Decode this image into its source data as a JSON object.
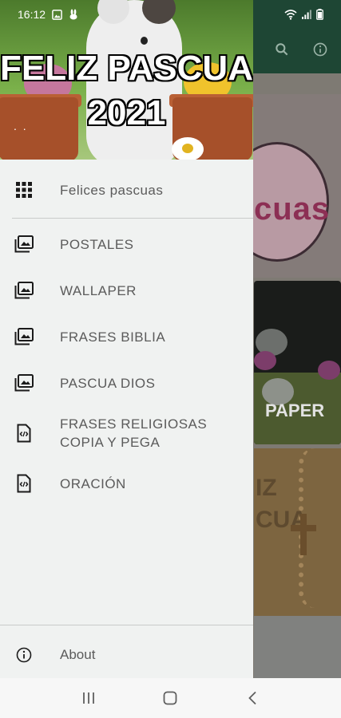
{
  "status_bar": {
    "time": "16:12"
  },
  "drawer": {
    "header": {
      "title_line1": "FELIZ PASCUA",
      "title_line2": "2021",
      "dots": ". ."
    },
    "items": [
      {
        "label": "Felices pascuas",
        "icon": "grid-icon"
      },
      {
        "label": "POSTALES",
        "icon": "image-gallery-icon"
      },
      {
        "label": "WALLAPER",
        "icon": "image-gallery-icon"
      },
      {
        "label": "FRASES BIBLIA",
        "icon": "image-gallery-icon"
      },
      {
        "label": "PASCUA DIOS",
        "icon": "image-gallery-icon"
      },
      {
        "label_line1": "FRASES RELIGIOSAS",
        "label_line2": "COPIA Y PEGA",
        "icon": "code-file-icon"
      },
      {
        "label": "ORACIÓN",
        "icon": "code-file-icon"
      }
    ],
    "footer": {
      "about_label": "About",
      "icon": "info-icon"
    }
  },
  "background": {
    "appbar_icons": [
      "search-icon",
      "info-icon"
    ],
    "tiles": {
      "egg_text": "cuas",
      "wallpaper_text": "PAPER",
      "oracion_line1": "IZ",
      "oracion_line2": "CUA"
    }
  },
  "navbar": {
    "buttons": [
      "recents-icon",
      "home-icon",
      "back-icon"
    ]
  },
  "colors": {
    "appbar": "#1e4634",
    "drawer_bg": "#f0f2f1",
    "label_gray": "#5b5b5b"
  }
}
